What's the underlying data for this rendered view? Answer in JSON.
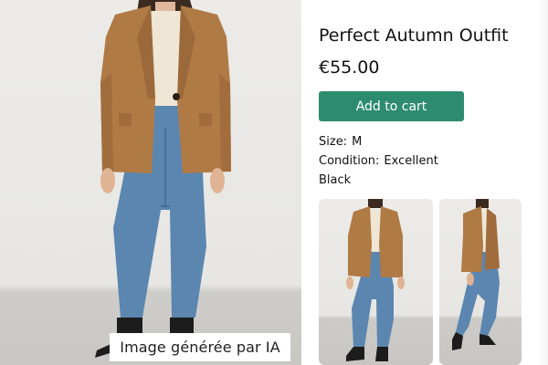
{
  "product": {
    "title": "Perfect Autumn Outfit",
    "price": "€55.00",
    "add_to_cart_label": "Add to cart",
    "size_label": "Size:",
    "size_value": "M",
    "condition_label": "Condition:",
    "condition_value": "Excellent",
    "color_value": "Black"
  },
  "main_image": {
    "badge_text": "Image générée par IA"
  },
  "colors": {
    "button": "#2e8c6e",
    "button_text": "#ffffff",
    "blazer": "#b07a45",
    "jeans": "#4f7ba6",
    "background": "#ffffff"
  },
  "thumbnails": [
    {
      "icon": "outfit-front-photo"
    },
    {
      "icon": "outfit-side-photo"
    }
  ]
}
